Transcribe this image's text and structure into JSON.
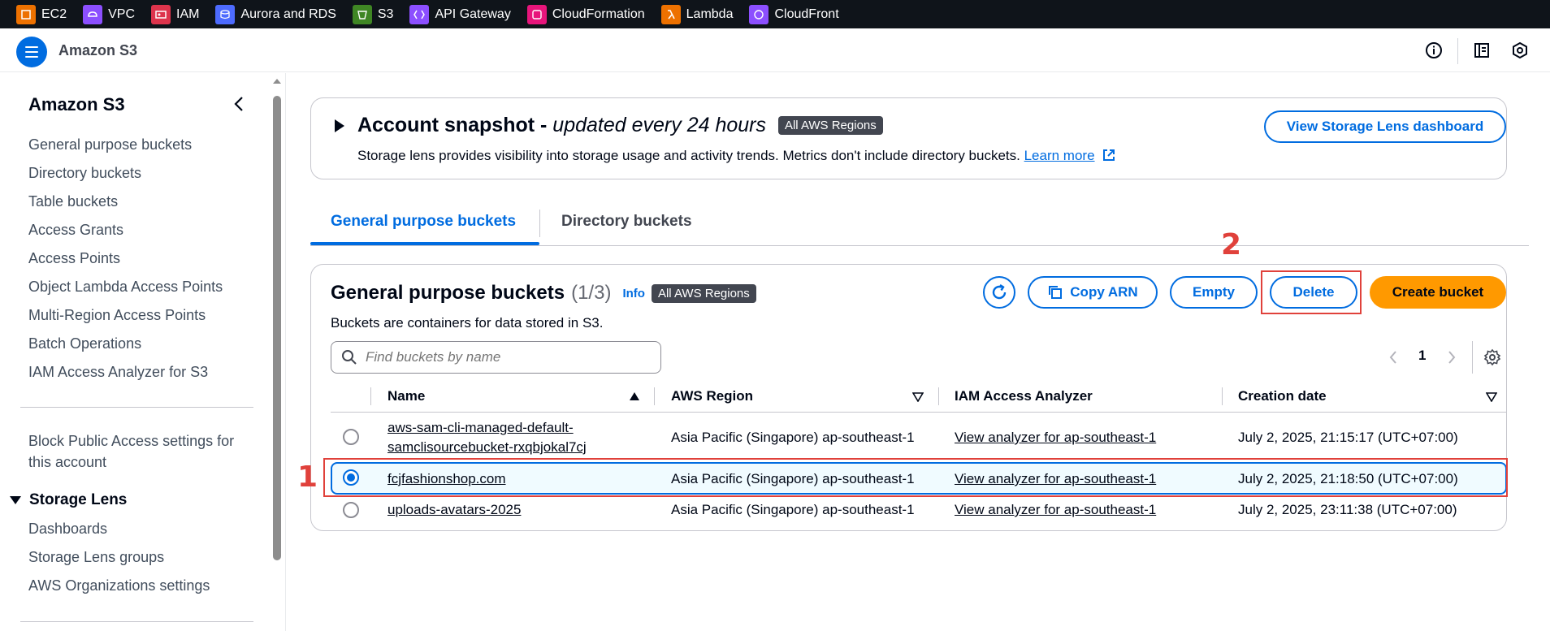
{
  "favorites": [
    {
      "label": "EC2",
      "icon": "ec2-icon",
      "color": "#ed7100"
    },
    {
      "label": "VPC",
      "icon": "vpc-icon",
      "color": "#8c4fff"
    },
    {
      "label": "IAM",
      "icon": "iam-icon",
      "color": "#dd344c"
    },
    {
      "label": "Aurora and RDS",
      "icon": "rds-icon",
      "color": "#4d6bfe"
    },
    {
      "label": "S3",
      "icon": "s3-icon",
      "color": "#3f8624"
    },
    {
      "label": "API Gateway",
      "icon": "api-gateway-icon",
      "color": "#8c4fff"
    },
    {
      "label": "CloudFormation",
      "icon": "cloudformation-icon",
      "color": "#e7157b"
    },
    {
      "label": "Lambda",
      "icon": "lambda-icon",
      "color": "#ed7100"
    },
    {
      "label": "CloudFront",
      "icon": "cloudfront-icon",
      "color": "#8c4fff"
    }
  ],
  "header": {
    "service_name": "Amazon S3"
  },
  "sidebar": {
    "title": "Amazon S3",
    "items": [
      "General purpose buckets",
      "Directory buckets",
      "Table buckets",
      "Access Grants",
      "Access Points",
      "Object Lambda Access Points",
      "Multi-Region Access Points",
      "Batch Operations",
      "IAM Access Analyzer for S3"
    ],
    "block_public_line1": "Block Public Access settings for",
    "block_public_line2": "this account",
    "storage_lens": {
      "title": "Storage Lens",
      "items": [
        "Dashboards",
        "Storage Lens groups",
        "AWS Organizations settings"
      ]
    }
  },
  "snapshot": {
    "title": "Account snapshot - ",
    "subtitle": "updated every 24 hours",
    "badge": "All AWS Regions",
    "description": "Storage lens provides visibility into storage usage and activity trends. Metrics don't include directory buckets. ",
    "learn_more": "Learn more",
    "button": "View Storage Lens dashboard"
  },
  "tabs": [
    "General purpose buckets",
    "Directory buckets"
  ],
  "buckets_panel": {
    "title": "General purpose buckets",
    "count": "(1/3)",
    "info": "Info",
    "badge": "All AWS Regions",
    "description": "Buckets are containers for data stored in S3.",
    "buttons": {
      "copy_arn": "Copy ARN",
      "empty": "Empty",
      "delete": "Delete",
      "create": "Create bucket"
    },
    "search_placeholder": "Find buckets by name",
    "page": "1",
    "columns": [
      "Name",
      "AWS Region",
      "IAM Access Analyzer",
      "Creation date"
    ],
    "rows": [
      {
        "name_line1": "aws-sam-cli-managed-default-",
        "name_line2": "samclisourcebucket-rxqbjokal7cj",
        "region": "Asia Pacific (Singapore) ap-southeast-1",
        "analyzer": "View analyzer for ap-southeast-1",
        "created": "July 2, 2025, 21:15:17 (UTC+07:00)",
        "selected": false
      },
      {
        "name": "fcjfashionshop.com",
        "region": "Asia Pacific (Singapore) ap-southeast-1",
        "analyzer": "View analyzer for ap-southeast-1",
        "created": "July 2, 2025, 21:18:50 (UTC+07:00)",
        "selected": true
      },
      {
        "name": "uploads-avatars-2025",
        "region": "Asia Pacific (Singapore) ap-southeast-1",
        "analyzer": "View analyzer for ap-southeast-1",
        "created": "July 2, 2025, 23:11:38 (UTC+07:00)",
        "selected": false
      }
    ]
  },
  "annotations": {
    "step1": "1",
    "step2": "2"
  }
}
